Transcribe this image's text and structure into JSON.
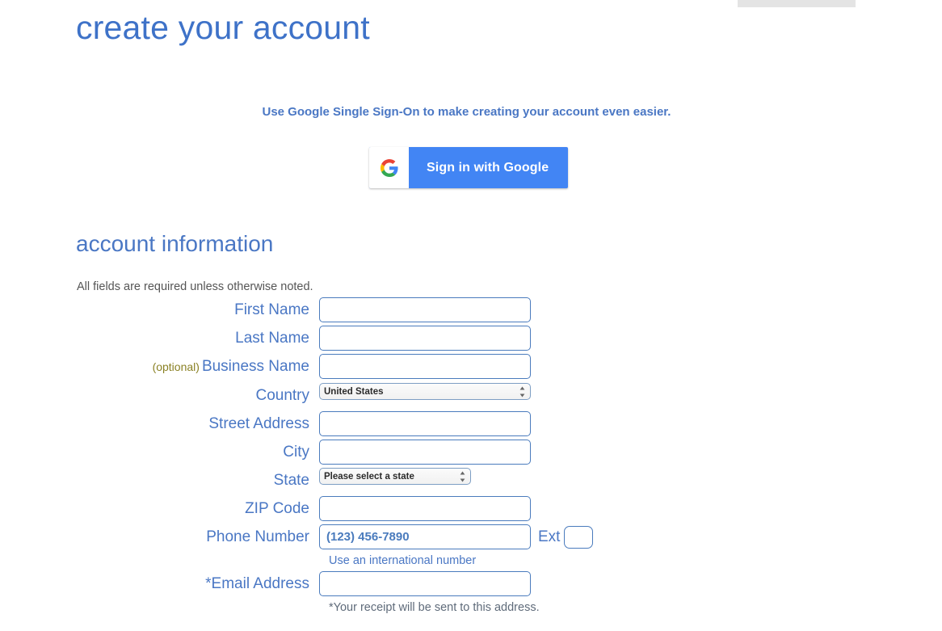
{
  "page": {
    "title": "create your account",
    "sso_note": "Use Google Single Sign-On to make creating your account even easier.",
    "section_title": "account information",
    "required_note": "All fields are required unless otherwise noted."
  },
  "google_button": {
    "label": "Sign in with Google",
    "icon": "google-g-icon",
    "background_color": "#4285F4",
    "text_color": "#FFFFFF"
  },
  "colors": {
    "heading_blue": "#3E72C8",
    "label_blue": "#4A77C4",
    "input_border_blue": "#4A7BBD",
    "optional_olive": "#8A8124",
    "note_grey": "#555555",
    "top_bar_grey": "#E4E4E4"
  },
  "form": {
    "fields": {
      "first_name": {
        "label": "First Name",
        "value": "",
        "placeholder": ""
      },
      "last_name": {
        "label": "Last Name",
        "value": "",
        "placeholder": ""
      },
      "business_name": {
        "optional_tag": "(optional)",
        "label": "Business Name",
        "value": "",
        "placeholder": ""
      },
      "country": {
        "label": "Country",
        "selected": "United States"
      },
      "street_address": {
        "label": "Street Address",
        "value": "",
        "placeholder": ""
      },
      "city": {
        "label": "City",
        "value": "",
        "placeholder": ""
      },
      "state": {
        "label": "State",
        "selected": "Please select a state"
      },
      "zip_code": {
        "label": "ZIP Code",
        "value": "",
        "placeholder": ""
      },
      "phone_number": {
        "label": "Phone Number",
        "value": "",
        "placeholder": "(123) 456-7890"
      },
      "ext": {
        "label": "Ext",
        "value": "",
        "placeholder": ""
      },
      "email_address": {
        "label": "*Email Address",
        "value": "",
        "placeholder": ""
      }
    },
    "hints": {
      "international_number": "Use an international number",
      "email_receipt": "*Your receipt will be sent to this address."
    }
  }
}
